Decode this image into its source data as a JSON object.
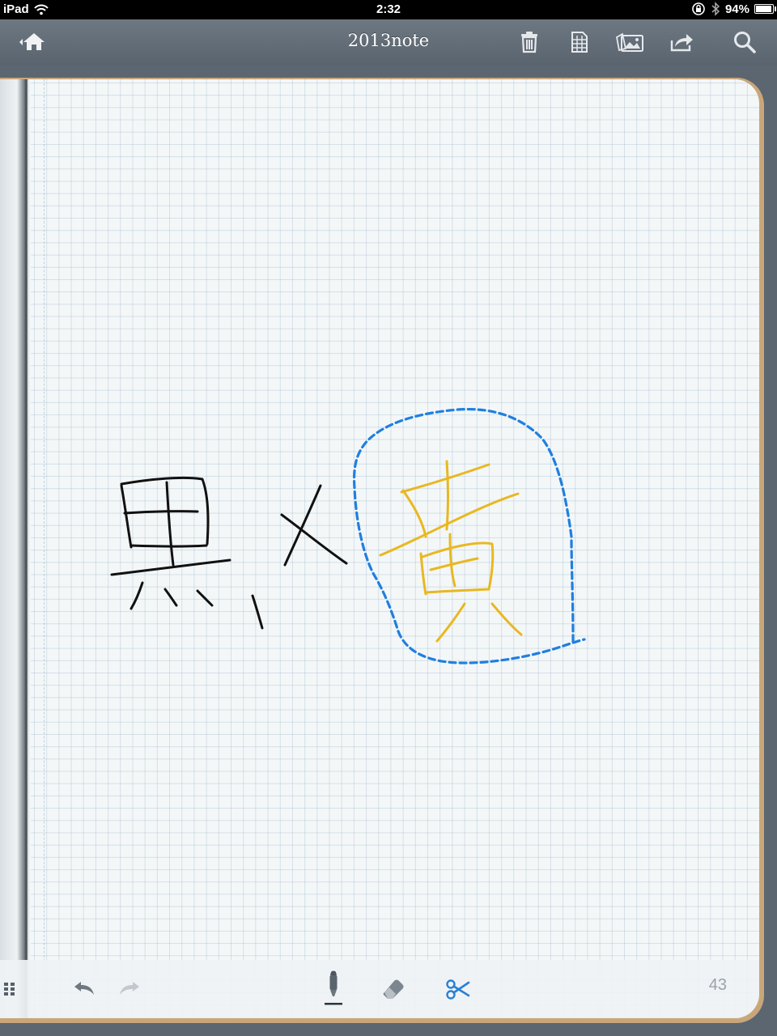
{
  "status_bar": {
    "device": "iPad",
    "time": "2:32",
    "battery": "94%",
    "battery_level": 0.94
  },
  "nav": {
    "title": "2013note",
    "icons": [
      "home-icon",
      "trash-icon",
      "page-grid-icon",
      "photos-icon",
      "share-icon",
      "search-icon"
    ]
  },
  "canvas": {
    "ink_colors": {
      "black_pen": "#111111",
      "yellow_pen": "#e8b820",
      "selection_lasso": "#1f7fe0"
    }
  },
  "toolbar": {
    "icons": [
      "grid-menu-icon",
      "undo-icon",
      "redo-icon",
      "pen-icon",
      "eraser-icon",
      "scissors-icon"
    ],
    "page_number": "43"
  },
  "colors": {
    "nav_bar": "#626c76",
    "page_background": "#f4f7f8",
    "notebook_edge": "#c9a67a",
    "active_tool": "#2a7fd4"
  }
}
